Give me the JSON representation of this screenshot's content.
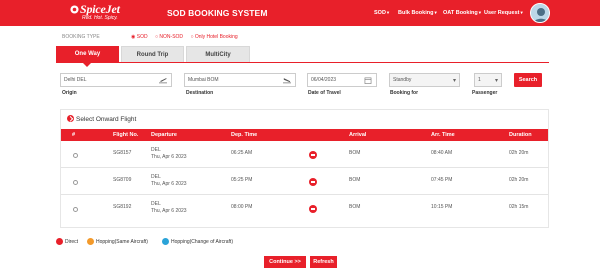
{
  "header": {
    "logo_word": "SpiceJet",
    "logo_tagline": "Red. Hot. Spicy.",
    "title": "SOD BOOKING SYSTEM",
    "nav": [
      "SOD",
      "Bulk Booking",
      "OAT Booking",
      "User Request"
    ],
    "colors": {
      "brand": "#e8202a"
    }
  },
  "booking_type": {
    "label": "BOOKING TYPE",
    "options": [
      "SOD",
      "NON-SOD",
      "Only Hotel Booking"
    ]
  },
  "tabs": [
    "One Way",
    "Round Trip",
    "MultiCity"
  ],
  "form": {
    "origin_value": "Delhi DEL",
    "origin_label": "Origin",
    "destination_value": "Mumbai BOM",
    "destination_label": "Destination",
    "date_value": "06/04/2023",
    "date_label": "Date of Travel",
    "booking_for_value": "Standby",
    "booking_for_label": "Booking for",
    "passenger_value": "1",
    "passenger_label": "Passenger",
    "search_label": "Search"
  },
  "results": {
    "title": "Select Onward Flight",
    "columns": [
      "#",
      "Flight No.",
      "Departure",
      "Dep. Time",
      "Arrival",
      "Arr. Time",
      "Duration"
    ],
    "rows": [
      {
        "flight": "SG8157",
        "dep_city": "DEL",
        "dep_date": "Thu, Apr 6 2023",
        "dep_time": "06:25 AM",
        "arrival": "BOM",
        "arr_time": "08:40 AM",
        "duration": "02h 20m"
      },
      {
        "flight": "SG8709",
        "dep_city": "DEL",
        "dep_date": "Thu, Apr 6 2023",
        "dep_time": "05:25 PM",
        "arrival": "BOM",
        "arr_time": "07:45 PM",
        "duration": "02h 20m"
      },
      {
        "flight": "SG8192",
        "dep_city": "DEL",
        "dep_date": "Thu, Apr 6 2023",
        "dep_time": "08:00 PM",
        "arrival": "BOM",
        "arr_time": "10:15 PM",
        "duration": "02h 15m"
      }
    ]
  },
  "legend": {
    "direct": "Direct",
    "hopping_same": "Hopping(Same Aircraft)",
    "hopping_change": "Hopping(Change of Aircraft)",
    "colors": {
      "direct": "#e8202a",
      "same": "#f39a2b",
      "change": "#2aa3d8"
    }
  },
  "actions": {
    "continue_label": "Continue >>",
    "refresh_label": "Refresh"
  }
}
